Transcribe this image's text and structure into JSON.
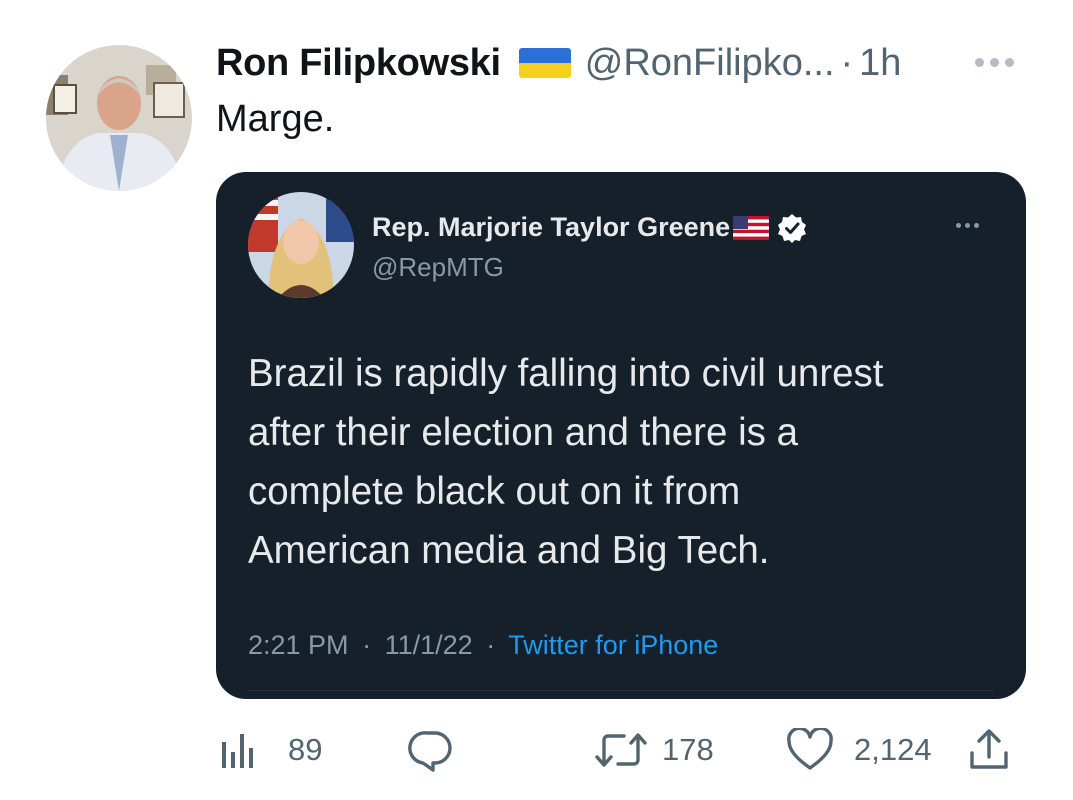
{
  "tweet": {
    "display_name": "Ron Filipkowski",
    "handle": "@RonFilipko...",
    "dot": "·",
    "time": "1h",
    "text": "Marge."
  },
  "quote": {
    "display_name": "Rep. Marjorie Taylor Greene",
    "handle": "@RepMTG",
    "lines": [
      "Brazil is rapidly falling into civil unrest",
      "after their election and there is a",
      "complete black out on it from",
      "American media and Big Tech."
    ],
    "time": "2:21 PM",
    "sep1": "·",
    "date": "11/1/22",
    "sep2": "·",
    "source": "Twitter for iPhone"
  },
  "actions": {
    "views": "89",
    "retweets": "178",
    "likes": "2,124"
  },
  "colors": {
    "quote_bg": "#15202b",
    "link": "#1d9bf0",
    "muted": "#536471"
  },
  "icons": [
    "more-icon",
    "ukraine-flag-icon",
    "us-flag-icon",
    "verified-badge-icon",
    "analytics-icon",
    "reply-icon",
    "retweet-icon",
    "like-icon",
    "share-icon"
  ]
}
